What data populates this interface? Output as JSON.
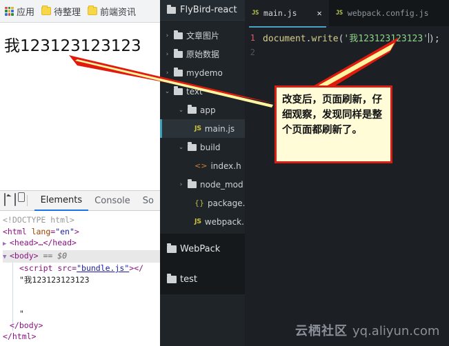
{
  "browser": {
    "bookmarks": [
      {
        "label": "应用",
        "icon": "apps-grid-icon"
      },
      {
        "label": "待整理",
        "icon": "folder-icon"
      },
      {
        "label": "前端资讯",
        "icon": "folder-icon"
      }
    ],
    "page_content": "我123123123123"
  },
  "devtools": {
    "toolbar_icons": [
      "inspect-element-icon",
      "device-toolbar-icon"
    ],
    "tabs": [
      {
        "label": "Elements",
        "active": true
      },
      {
        "label": "Console",
        "active": false
      },
      {
        "label": "So",
        "active": false
      }
    ],
    "dom": {
      "doctype": "<!DOCTYPE html>",
      "html_open_tag": "<html",
      "html_attr_name": "lang",
      "html_attr_value": "\"en\"",
      "html_close_bracket": ">",
      "head_collapsed": "<head>…</head>",
      "body_open": "<body>",
      "body_selected_marker": "== $0",
      "script_open": "<script src=",
      "script_src": "\"bundle.js\"",
      "script_close": "></",
      "text_node": "\"我123123123123",
      "text_node_end": "\"",
      "body_close": "</body>",
      "html_close": "</html>"
    }
  },
  "tree": {
    "project_title": "FlyBird-react",
    "project_icon": "folder-icon",
    "items": [
      {
        "label": "文章图片",
        "icon": "folder-icon",
        "chevron": "›",
        "indent": 0,
        "selected": false
      },
      {
        "label": "原始数据",
        "icon": "folder-icon",
        "chevron": "›",
        "indent": 0,
        "selected": false
      },
      {
        "label": "mydemo",
        "icon": "folder-icon",
        "chevron": "›",
        "indent": 0,
        "selected": false
      },
      {
        "label": "text",
        "icon": "folder-icon",
        "chevron": "⌄",
        "indent": 0,
        "selected": false
      },
      {
        "label": "app",
        "icon": "folder-icon",
        "chevron": "⌄",
        "indent": 1,
        "selected": false
      },
      {
        "label": "main.js",
        "icon": "js-file-icon",
        "badge": "JS",
        "chevron": "",
        "indent": 2,
        "selected": true
      },
      {
        "label": "build",
        "icon": "folder-icon",
        "chevron": "⌄",
        "indent": 1,
        "selected": false
      },
      {
        "label": "index.h",
        "icon": "html-file-icon",
        "badge": "<>",
        "chevron": "",
        "indent": 2,
        "selected": false
      },
      {
        "label": "node_mod",
        "icon": "folder-icon",
        "chevron": "›",
        "indent": 1,
        "selected": false
      },
      {
        "label": "package.j",
        "icon": "json-file-icon",
        "badge": "{}",
        "chevron": "",
        "indent": 2,
        "selected": false
      },
      {
        "label": "webpack.",
        "icon": "js-file-icon",
        "badge": "JS",
        "chevron": "",
        "indent": 2,
        "selected": false
      }
    ],
    "sections": [
      {
        "label": "WebPack",
        "icon": "folder-icon"
      },
      {
        "label": "test",
        "icon": "folder-icon"
      }
    ]
  },
  "editor": {
    "tabs": [
      {
        "label": "main.js",
        "icon": "js-file-icon",
        "active": true,
        "close": "✕"
      },
      {
        "label": "webpack.config.js",
        "icon": "js-file-icon",
        "active": false,
        "close": ""
      }
    ],
    "line_numbers": [
      "1",
      "2"
    ],
    "code": {
      "object": "document",
      "dot": ".",
      "method": "write",
      "open_paren": "(",
      "string": "'我123123123123'",
      "close_paren": ")",
      "semicolon": ";"
    }
  },
  "annotation": {
    "text": "改变后，页面刷新，仔细观察，发现同样是整个页面都刷新了。",
    "border_color": "#d91f13",
    "background_color": "#fffcd7"
  },
  "watermark": {
    "cn": "云栖社区",
    "url": "yq.aliyun.com"
  },
  "colors": {
    "arrow": "#e01b0e",
    "arrow_highlight": "#fff4a0",
    "editor_bg": "#1c2025",
    "tree_bg": "#1f2428",
    "accent": "#1a73e8",
    "selection": "#3a9fb8"
  }
}
